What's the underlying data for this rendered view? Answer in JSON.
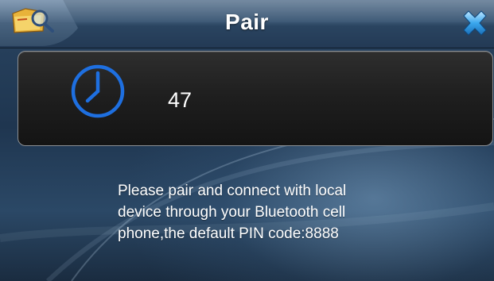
{
  "window": {
    "title": "Pair",
    "app_icon": "app-search-icon",
    "close_icon": "close-icon"
  },
  "timer": {
    "icon": "clock-icon",
    "countdown": "47"
  },
  "message": {
    "line1": "Please pair and connect with local",
    "line2": "device through your Bluetooth cell",
    "line3": "phone,the default PIN code:8888"
  },
  "colors": {
    "clock_blue": "#1e6fe0",
    "close_blue": "#3aa7ee",
    "background": "#1f3650"
  }
}
